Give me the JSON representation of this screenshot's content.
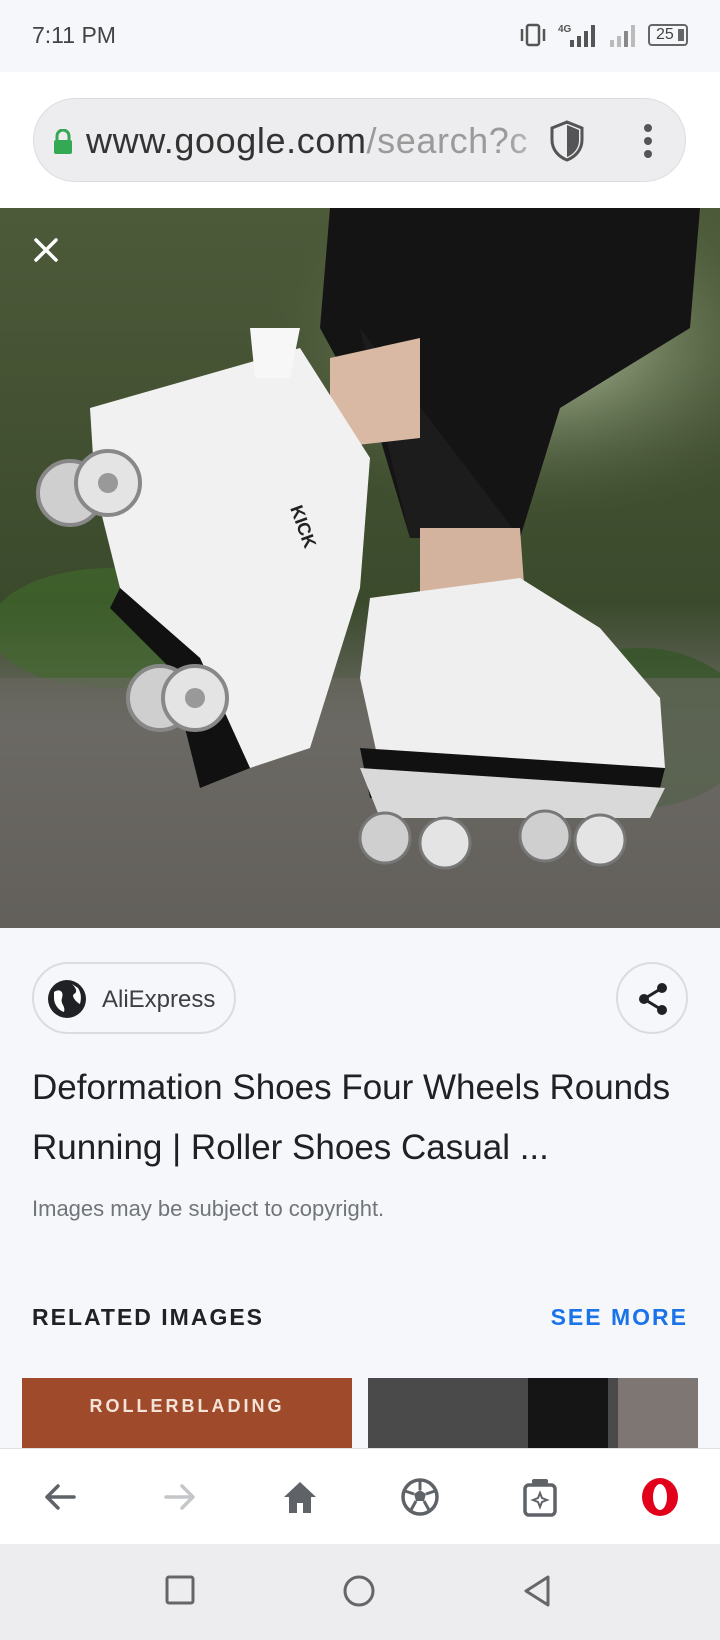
{
  "status_bar": {
    "time": "7:11 PM",
    "network_label": "4G",
    "battery_level": "25"
  },
  "url_bar": {
    "domain": "www.google.com",
    "path": "/search?c",
    "lock_icon": "lock-icon",
    "shield_icon": "shield-icon",
    "menu_icon": "more-vert-icon"
  },
  "image": {
    "description_icon": "close-icon"
  },
  "source": {
    "name": "AliExpress",
    "icon": "globe-icon"
  },
  "result": {
    "title": "Deformation Shoes Four Wheels Rounds Running | Roller Shoes Casual ...",
    "copyright_note": "Images may be subject to copyright."
  },
  "related": {
    "heading": "RELATED IMAGES",
    "see_more": "SEE MORE",
    "thumb1_text": "ROLLERBLADING"
  },
  "bottom_bar": {
    "icons": [
      "back-icon",
      "forward-icon",
      "home-icon",
      "soccer-ball-icon",
      "tabs-icon",
      "opera-icon"
    ]
  },
  "system_nav": {
    "icons": [
      "recents-icon",
      "home-circle-icon",
      "back-triangle-icon"
    ]
  },
  "colors": {
    "accent": "#1a73e8",
    "opera_red": "#e3001b",
    "lock_green": "#34a853"
  }
}
